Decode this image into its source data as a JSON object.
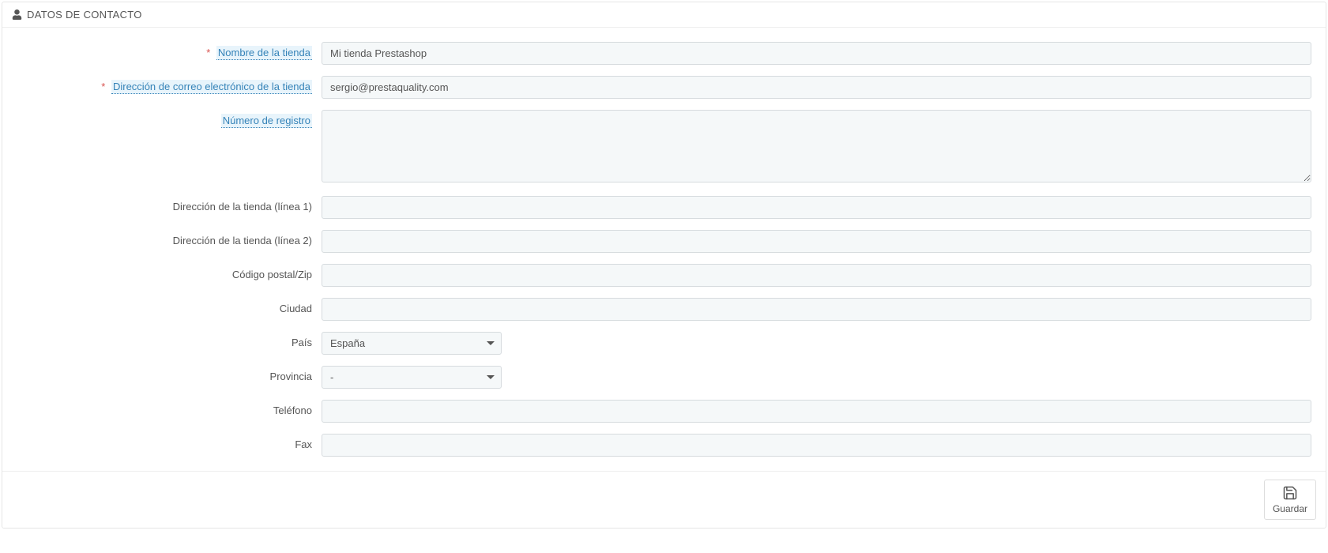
{
  "panel": {
    "title": "DATOS DE CONTACTO"
  },
  "form": {
    "shop_name": {
      "label": "Nombre de la tienda",
      "value": "Mi tienda Prestashop",
      "required": true,
      "tooltip": true
    },
    "shop_email": {
      "label": "Dirección de correo electrónico de la tienda",
      "value": "sergio@prestaquality.com",
      "required": true,
      "tooltip": true
    },
    "registration_number": {
      "label": "Número de registro",
      "value": "",
      "tooltip": true
    },
    "address1": {
      "label": "Dirección de la tienda (línea 1)",
      "value": ""
    },
    "address2": {
      "label": "Dirección de la tienda (línea 2)",
      "value": ""
    },
    "postcode": {
      "label": "Código postal/Zip",
      "value": ""
    },
    "city": {
      "label": "Ciudad",
      "value": ""
    },
    "country": {
      "label": "País",
      "selected": "España"
    },
    "state": {
      "label": "Provincia",
      "selected": "-"
    },
    "phone": {
      "label": "Teléfono",
      "value": ""
    },
    "fax": {
      "label": "Fax",
      "value": ""
    }
  },
  "actions": {
    "save": "Guardar"
  }
}
